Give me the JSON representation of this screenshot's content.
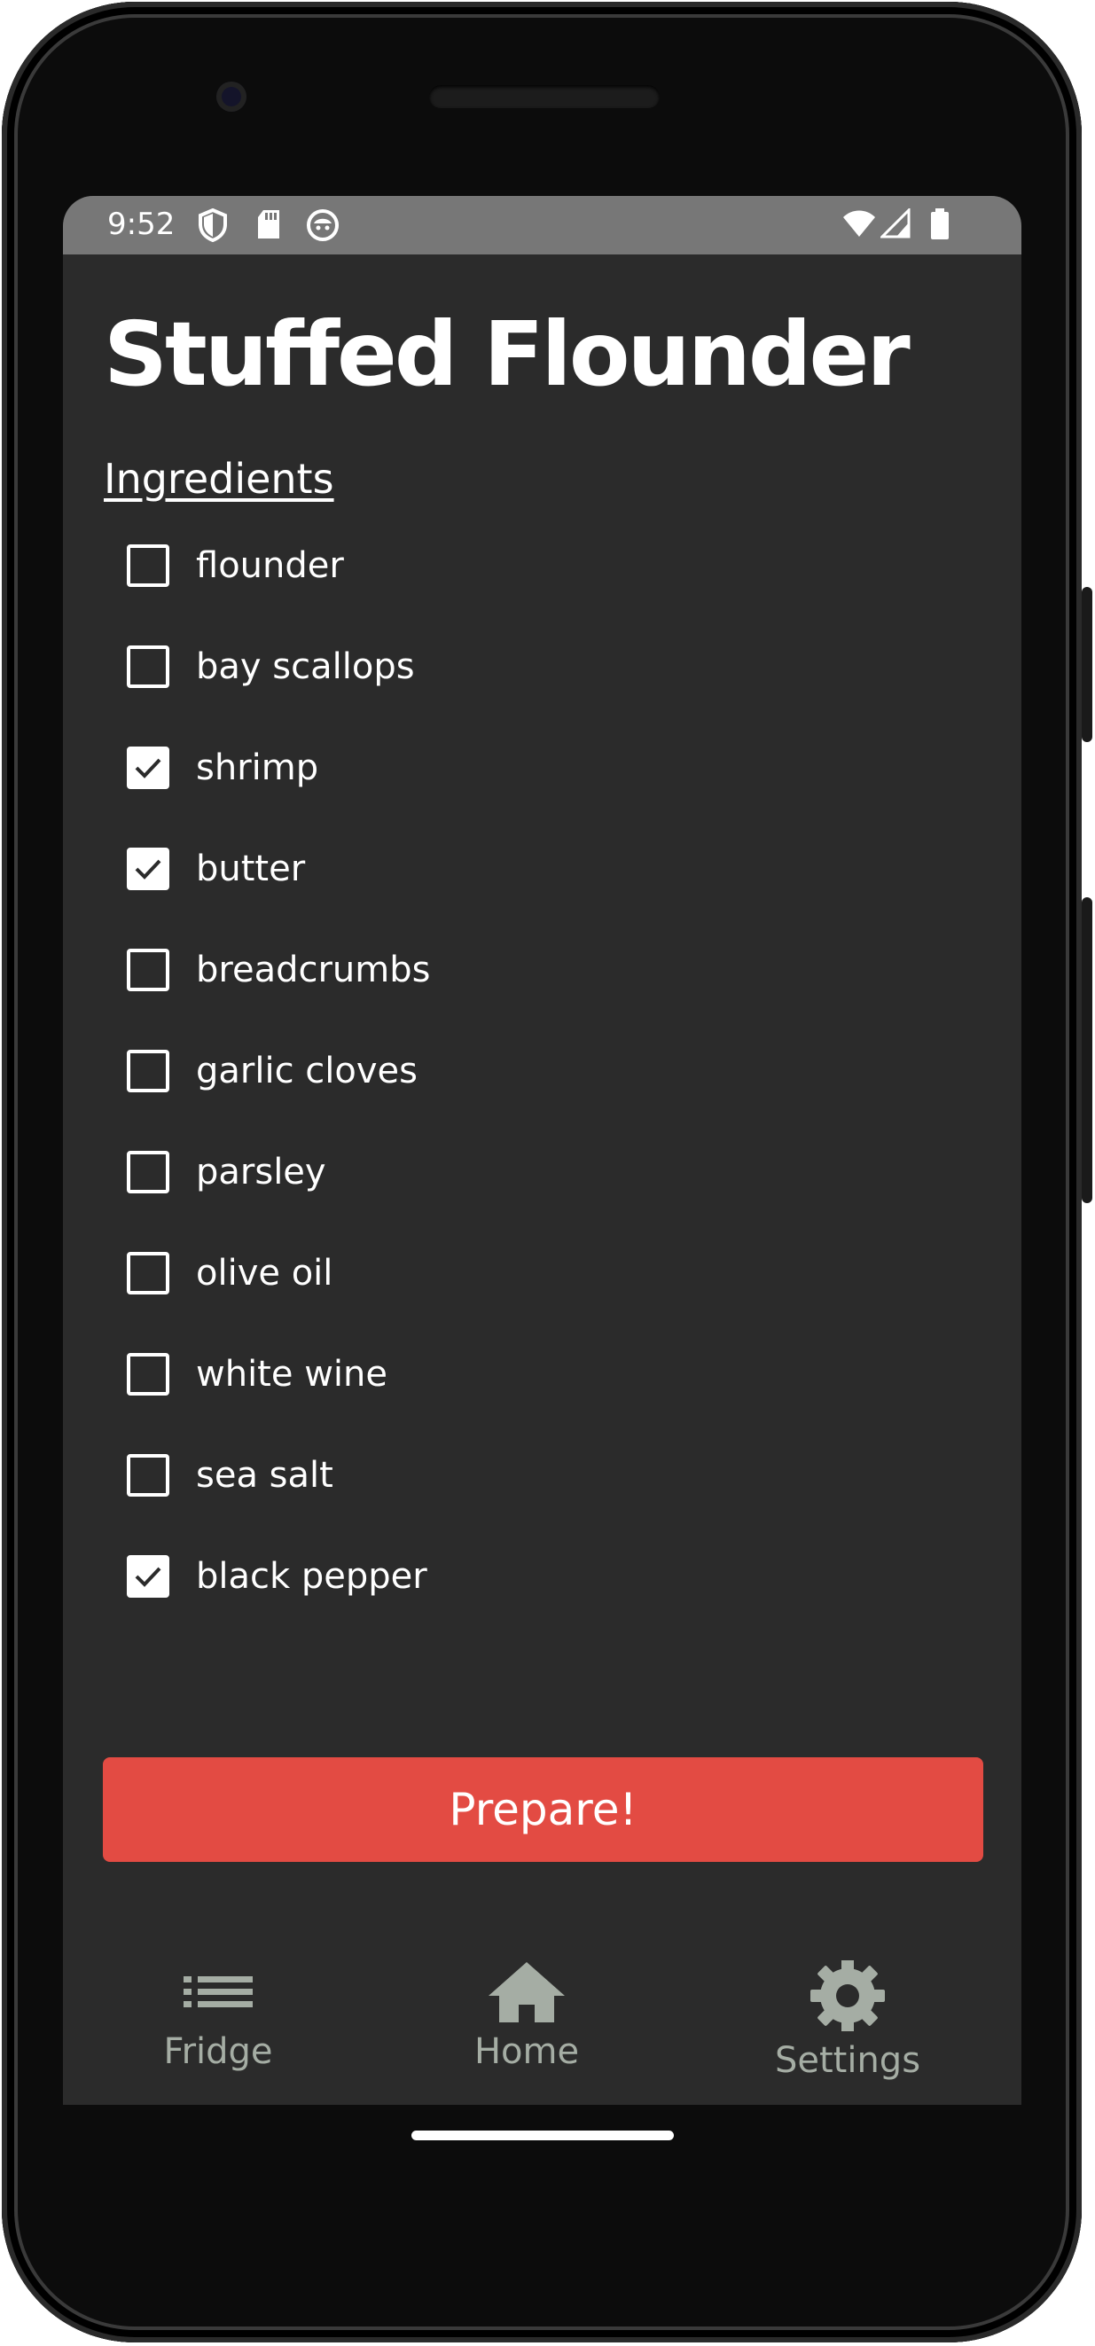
{
  "status_bar": {
    "time": "9:52",
    "icons": [
      "shield-icon",
      "sd-card-icon",
      "face-icon",
      "wifi-icon",
      "signal-icon",
      "battery-icon"
    ]
  },
  "recipe": {
    "title": "Stuffed Flounder",
    "section_label": "Ingredients",
    "ingredients": [
      {
        "name": "flounder",
        "checked": false
      },
      {
        "name": "bay scallops",
        "checked": false
      },
      {
        "name": "shrimp",
        "checked": true
      },
      {
        "name": "butter",
        "checked": true
      },
      {
        "name": "breadcrumbs",
        "checked": false
      },
      {
        "name": "garlic cloves",
        "checked": false
      },
      {
        "name": "parsley",
        "checked": false
      },
      {
        "name": "olive oil",
        "checked": false
      },
      {
        "name": "white wine",
        "checked": false
      },
      {
        "name": "sea salt",
        "checked": false
      },
      {
        "name": "black pepper",
        "checked": true
      }
    ],
    "prepare_label": "Prepare!"
  },
  "bottom_nav": {
    "items": [
      {
        "label": "Fridge",
        "icon": "list-icon"
      },
      {
        "label": "Home",
        "icon": "home-icon"
      },
      {
        "label": "Settings",
        "icon": "gear-icon"
      }
    ]
  },
  "colors": {
    "background": "#2b2b2b",
    "status_bar": "#777777",
    "accent": "#e34b43",
    "nav_icon": "#a5ada4",
    "text": "#ffffff"
  }
}
